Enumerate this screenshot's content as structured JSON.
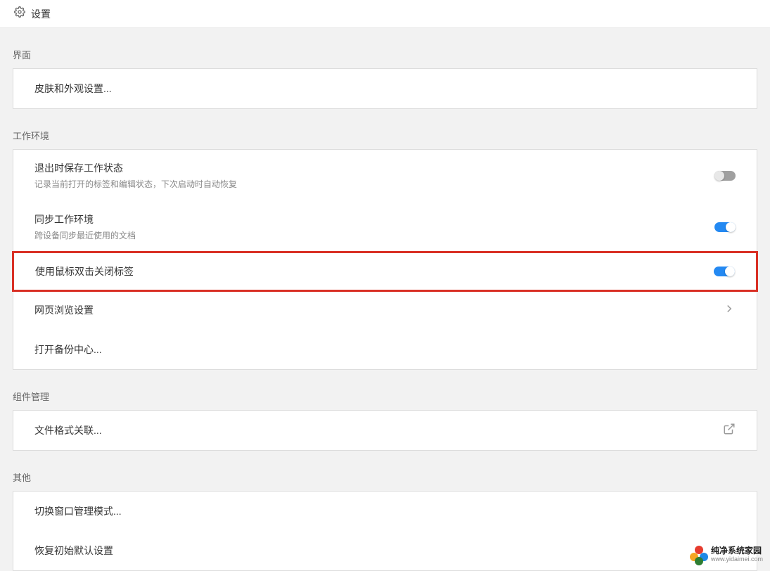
{
  "header": {
    "title": "设置"
  },
  "sections": {
    "interface": {
      "label": "界面",
      "skin": "皮肤和外观设置..."
    },
    "workspace": {
      "label": "工作环境",
      "saveOnExit": {
        "title": "退出时保存工作状态",
        "sub": "记录当前打开的标签和编辑状态，下次启动时自动恢复",
        "enabled": false
      },
      "syncWorkspace": {
        "title": "同步工作环境",
        "sub": "跨设备同步最近使用的文档",
        "enabled": true
      },
      "doubleClickCloseTab": {
        "title": "使用鼠标双击关闭标签",
        "enabled": true
      },
      "webBrowse": {
        "title": "网页浏览设置"
      },
      "backupCenter": {
        "title": "打开备份中心..."
      }
    },
    "components": {
      "label": "组件管理",
      "fileAssoc": {
        "title": "文件格式关联..."
      }
    },
    "other": {
      "label": "其他",
      "windowMode": {
        "title": "切换窗口管理模式..."
      },
      "resetDefaults": {
        "title": "恢复初始默认设置"
      }
    }
  },
  "watermark": {
    "line1": "纯净系统家园",
    "line2": "www.yidaimei.com"
  }
}
